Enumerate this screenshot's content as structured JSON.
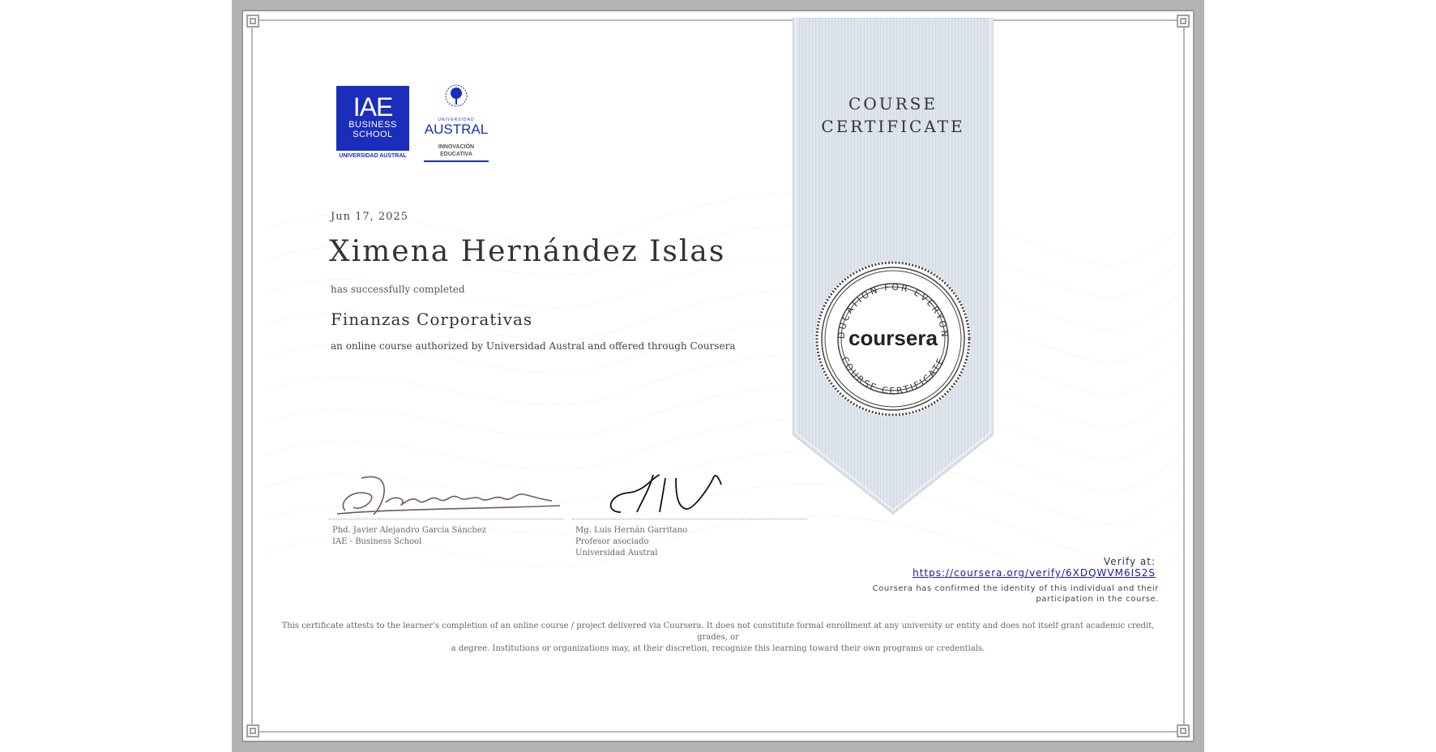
{
  "certificate": {
    "date": "Jun 17, 2025",
    "recipient_name": "Ximena Hernández Islas",
    "completed_text": "has successfully completed",
    "course_name": "Finanzas Corporativas",
    "offered_text": "an online course authorized by Universidad Austral and offered through Coursera",
    "ribbon_title_line1": "COURSE",
    "ribbon_title_line2": "CERTIFICATE"
  },
  "logos": {
    "iae": {
      "big": "IAE",
      "line1": "BUSINESS",
      "line2": "SCHOOL",
      "footer": "UNIVERSIDAD AUSTRAL",
      "color": "#1a2dbb"
    },
    "austral": {
      "small": "UNIVERSIDAD",
      "name": "AUSTRAL",
      "sub1": "INNOVACIÓN",
      "sub2": "EDUCATIVA"
    }
  },
  "seal": {
    "brand": "coursera",
    "ring_top": "EDUCATION FOR EVERYONE",
    "ring_bottom": "COURSE CERTIFICATE"
  },
  "signatures": [
    {
      "line1": "Phd. Javier Alejandro García Sánchez",
      "line2": "IAE - Business School",
      "line3": ""
    },
    {
      "line1": "Mg. Luis Hernán Garritano",
      "line2": "Profesor asociado",
      "line3": "Universidad Austral"
    }
  ],
  "verification": {
    "label": "Verify at:",
    "url": "https://coursera.org/verify/6XDQWVM6IS2S",
    "confirm_line1": "Coursera has confirmed the identity of this individual and their",
    "confirm_line2": "participation in the course."
  },
  "disclaimer": {
    "line1": "This certificate attests to the learner's completion of an online course / project delivered via Coursera. It does not constitute formal enrollment at any university or entity and does not itself grant academic credit, grades, or",
    "line2": "a degree. Institutions or organizations may, at their discretion, recognize this learning toward their own programs or credentials."
  },
  "colors": {
    "ribbon": "#dde3ea",
    "link": "#1a1aa8",
    "frame": "#b3b3b3"
  }
}
